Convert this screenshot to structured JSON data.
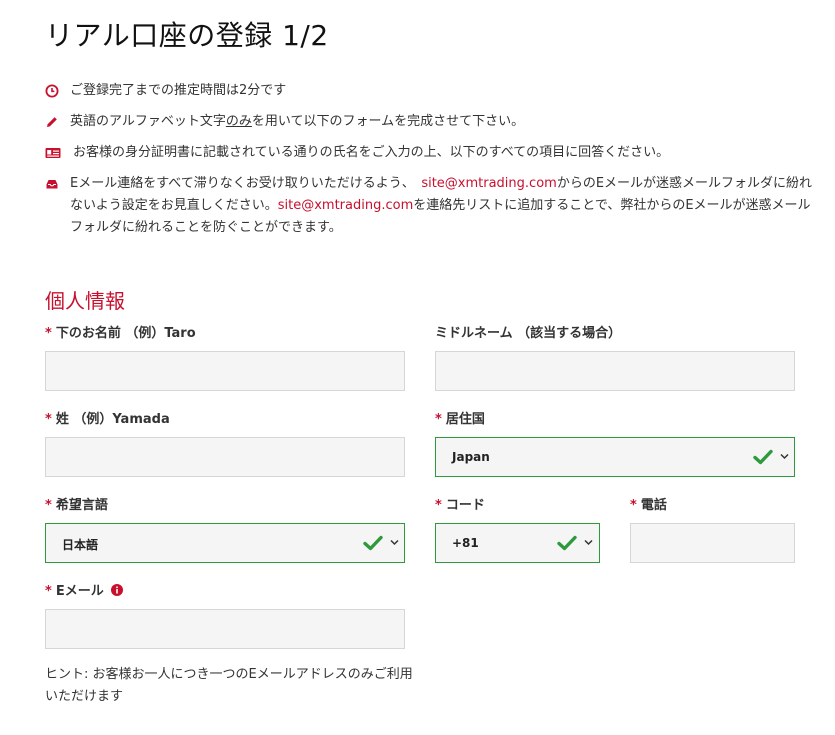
{
  "page": {
    "title": "リアル口座の登録 1/2"
  },
  "notes": [
    {
      "icon": "clock-icon",
      "text": "ご登録完了までの推定時間は2分です"
    },
    {
      "icon": "pencil-icon",
      "text_before": "英語のアルファベット文字",
      "text_underline": "のみ",
      "text_after": "を用いて以下のフォームを完成させて下さい。"
    },
    {
      "icon": "id-card-icon",
      "text": "お客様の身分証明書に記載されている通りの氏名をご入力の上、以下のすべての項目に回答ください。"
    },
    {
      "icon": "inbox-icon",
      "part1": "Eメール連絡をすべて滞りなくお受け取りいただけるよう、",
      "email1": "site@xmtrading.com",
      "part2": "からのEメールが迷惑メールフォルダに紛れないよう設定をお見直しください。",
      "email2": "site@xmtrading.com",
      "part3": "を連絡先リストに追加することで、弊社からのEメールが迷惑メールフォルダに紛れることを防ぐことができます。"
    }
  ],
  "section": {
    "title": "個人情報"
  },
  "form": {
    "required_mark": "*",
    "first_name_label": "下のお名前 （例）Taro",
    "middle_name_label": "ミドルネーム （該当する場合）",
    "last_name_label": "姓 （例）Yamada",
    "country_label": "居住国",
    "country_value": "Japan",
    "language_label": "希望言語",
    "language_value": "日本語",
    "code_label": "コード",
    "code_value": "+81",
    "phone_label": "電話",
    "email_label": "Eメール",
    "hint": "ヒント: お客様お一人につき一つのEメールアドレスのみご利用いただけます"
  },
  "colors": {
    "accent": "#c8102e",
    "valid": "#2e9a3c"
  }
}
